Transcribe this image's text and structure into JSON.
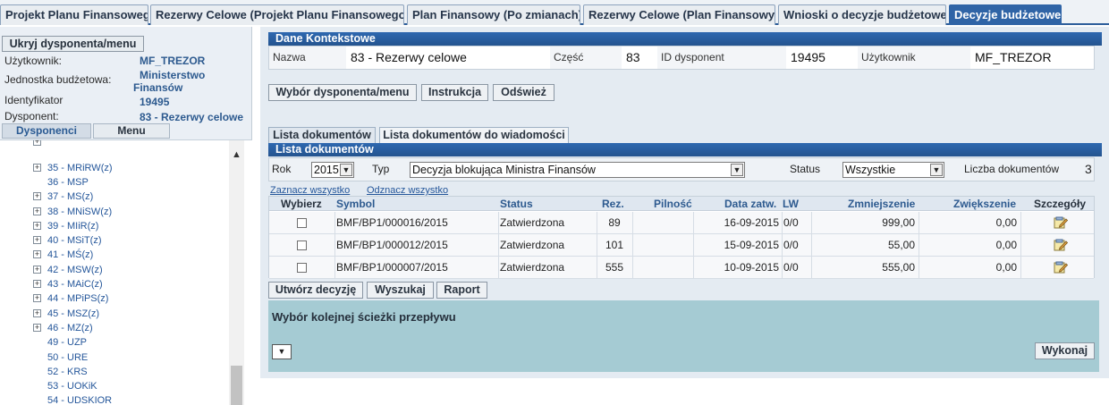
{
  "top_tabs": [
    {
      "label": "Projekt Planu Finansowego",
      "active": false
    },
    {
      "label": "Rezerwy Celowe (Projekt Planu Finansowego)",
      "active": false
    },
    {
      "label": "Plan Finansowy (Po zmianach)",
      "active": false
    },
    {
      "label": "Rezerwy Celowe (Plan Finansowy)",
      "active": false
    },
    {
      "label": "Wnioski o decyzje budżetowe",
      "active": false
    },
    {
      "label": "Decyzje budżetowe",
      "active": true
    }
  ],
  "sidebar": {
    "hide_button": "Ukryj dysponenta/menu",
    "user_label": "Użytkownik:",
    "user_value": "MF_TREZOR",
    "unit_label": "Jednostka budżetowa:",
    "unit_value_1": "Ministerstwo",
    "unit_value_2": "Finansów",
    "id_label": "Identyfikator",
    "id_value": "19495",
    "disp_label": "Dysponent:",
    "disp_value": "83 - Rezerwy celowe",
    "tabs": [
      {
        "label": "Dysponenci",
        "active": true
      },
      {
        "label": "Menu",
        "active": false
      }
    ],
    "tree_items": [
      {
        "label": "35 - MRiRW(z)",
        "expandable": true
      },
      {
        "label": "36 - MSP",
        "expandable": false
      },
      {
        "label": "37 - MS(z)",
        "expandable": true
      },
      {
        "label": "38 - MNiSW(z)",
        "expandable": true
      },
      {
        "label": "39 - MIiR(z)",
        "expandable": true
      },
      {
        "label": "40 - MSiT(z)",
        "expandable": true
      },
      {
        "label": "41 - MŚ(z)",
        "expandable": true
      },
      {
        "label": "42 - MSW(z)",
        "expandable": true
      },
      {
        "label": "43 - MAiC(z)",
        "expandable": true
      },
      {
        "label": "44 - MPiPS(z)",
        "expandable": true
      },
      {
        "label": "45 - MSZ(z)",
        "expandable": true
      },
      {
        "label": "46 - MZ(z)",
        "expandable": true
      },
      {
        "label": "49 - UZP",
        "expandable": false
      },
      {
        "label": "50 - URE",
        "expandable": false
      },
      {
        "label": "52 - KRS",
        "expandable": false
      },
      {
        "label": "53 - UOKiK",
        "expandable": false
      },
      {
        "label": "54 - UDSKIOR",
        "expandable": false
      }
    ]
  },
  "context": {
    "title": "Dane Kontekstowe",
    "name_label": "Nazwa",
    "name_value": "83 - Rezerwy celowe",
    "part_label": "Część",
    "part_value": "83",
    "disp_id_label": "ID dysponent",
    "disp_id_value": "19495",
    "user_label": "Użytkownik",
    "user_value": "MF_TREZOR"
  },
  "actions": {
    "choose_disp": "Wybór dysponenta/menu",
    "instructions": "Instrukcja",
    "refresh": "Odśwież"
  },
  "doc_tabs": [
    {
      "label": "Lista dokumentów",
      "active": true
    },
    {
      "label": "Lista dokumentów do wiadomości",
      "active": false
    }
  ],
  "doc_list": {
    "title": "Lista dokumentów",
    "year_label": "Rok",
    "year_value": "2015",
    "type_label": "Typ",
    "type_value": "Decyzja blokująca Ministra Finansów",
    "status_label": "Status",
    "status_value": "Wszystkie",
    "count_label": "Liczba dokumentów",
    "count_value": "3",
    "select_all": "Zaznacz wszystko",
    "deselect_all": "Odznacz wszystko"
  },
  "table": {
    "headers": {
      "select": "Wybierz",
      "symbol": "Symbol",
      "status": "Status",
      "rez": "Rez.",
      "urgency": "Pilność",
      "date": "Data zatw.",
      "lw": "LW",
      "decrease": "Zmniejszenie",
      "increase": "Zwiększenie",
      "details": "Szczegóły"
    },
    "rows": [
      {
        "symbol": "BMF/BP1/000016/2015",
        "status": "Zatwierdzona",
        "rez": "89",
        "urgency": "",
        "date": "16-09-2015",
        "lw": "0/0",
        "decrease": "999,00",
        "increase": "0,00"
      },
      {
        "symbol": "BMF/BP1/000012/2015",
        "status": "Zatwierdzona",
        "rez": "101",
        "urgency": "",
        "date": "15-09-2015",
        "lw": "0/0",
        "decrease": "55,00",
        "increase": "0,00"
      },
      {
        "symbol": "BMF/BP1/000007/2015",
        "status": "Zatwierdzona",
        "rez": "555",
        "urgency": "",
        "date": "10-09-2015",
        "lw": "0/0",
        "decrease": "555,00",
        "increase": "0,00"
      }
    ]
  },
  "bottom_actions": {
    "create": "Utwórz decyzję",
    "search": "Wyszukaj",
    "report": "Raport"
  },
  "flow": {
    "title": "Wybór kolejnej ścieżki przepływu",
    "execute": "Wykonaj"
  }
}
